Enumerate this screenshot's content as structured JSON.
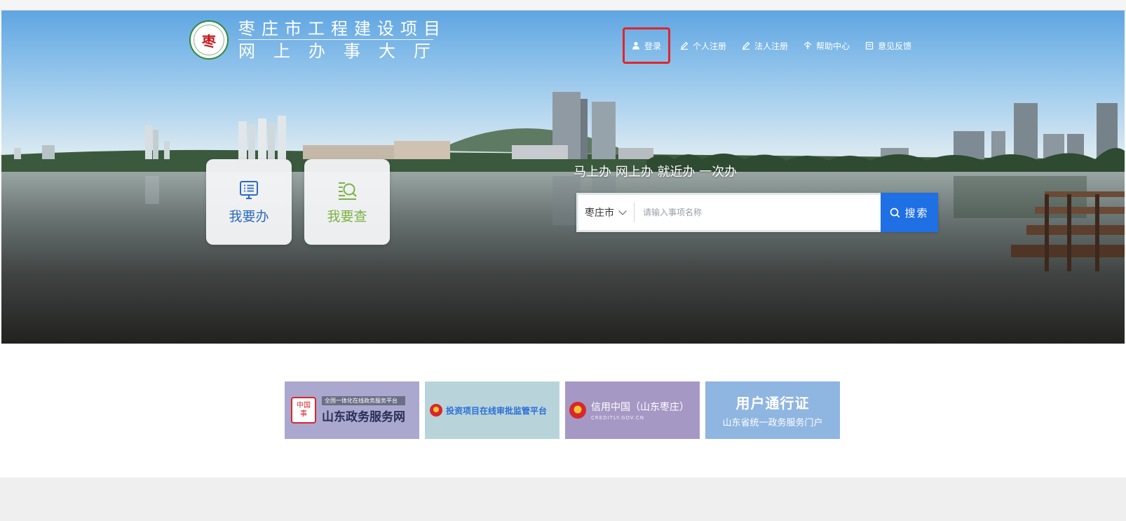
{
  "logo": {
    "line1": "枣庄市工程建设项目",
    "line2": "网上办事大厅",
    "emblem_char": "枣"
  },
  "nav": {
    "login": "登录",
    "personal_register": "个人注册",
    "legal_register": "法人注册",
    "help_center": "帮助中心",
    "feedback": "意见反馈"
  },
  "tiles": {
    "do": "我要办",
    "check": "我要查"
  },
  "slogan": "马上办 网上办 就近办 一次办",
  "search": {
    "city": "枣庄市",
    "placeholder": "请输入事项名称",
    "button": "搜索"
  },
  "banners": {
    "b1": {
      "small": "全国一体化在线政务服务平台",
      "title": "山东政务服务网",
      "seal": "中国事"
    },
    "b2": {
      "title": "投资项目在线审批监管平台"
    },
    "b3": {
      "title": "信用中国（山东枣庄）",
      "sub": "CREDITLY.GOV.CN"
    },
    "b4": {
      "title": "用户通行证",
      "sub": "山东省统一政务服务门户"
    }
  },
  "colors": {
    "accent": "#1f6fe5",
    "login_highlight": "#e0262b",
    "tile_do": "#2b6bbf",
    "tile_check": "#7cb342"
  }
}
